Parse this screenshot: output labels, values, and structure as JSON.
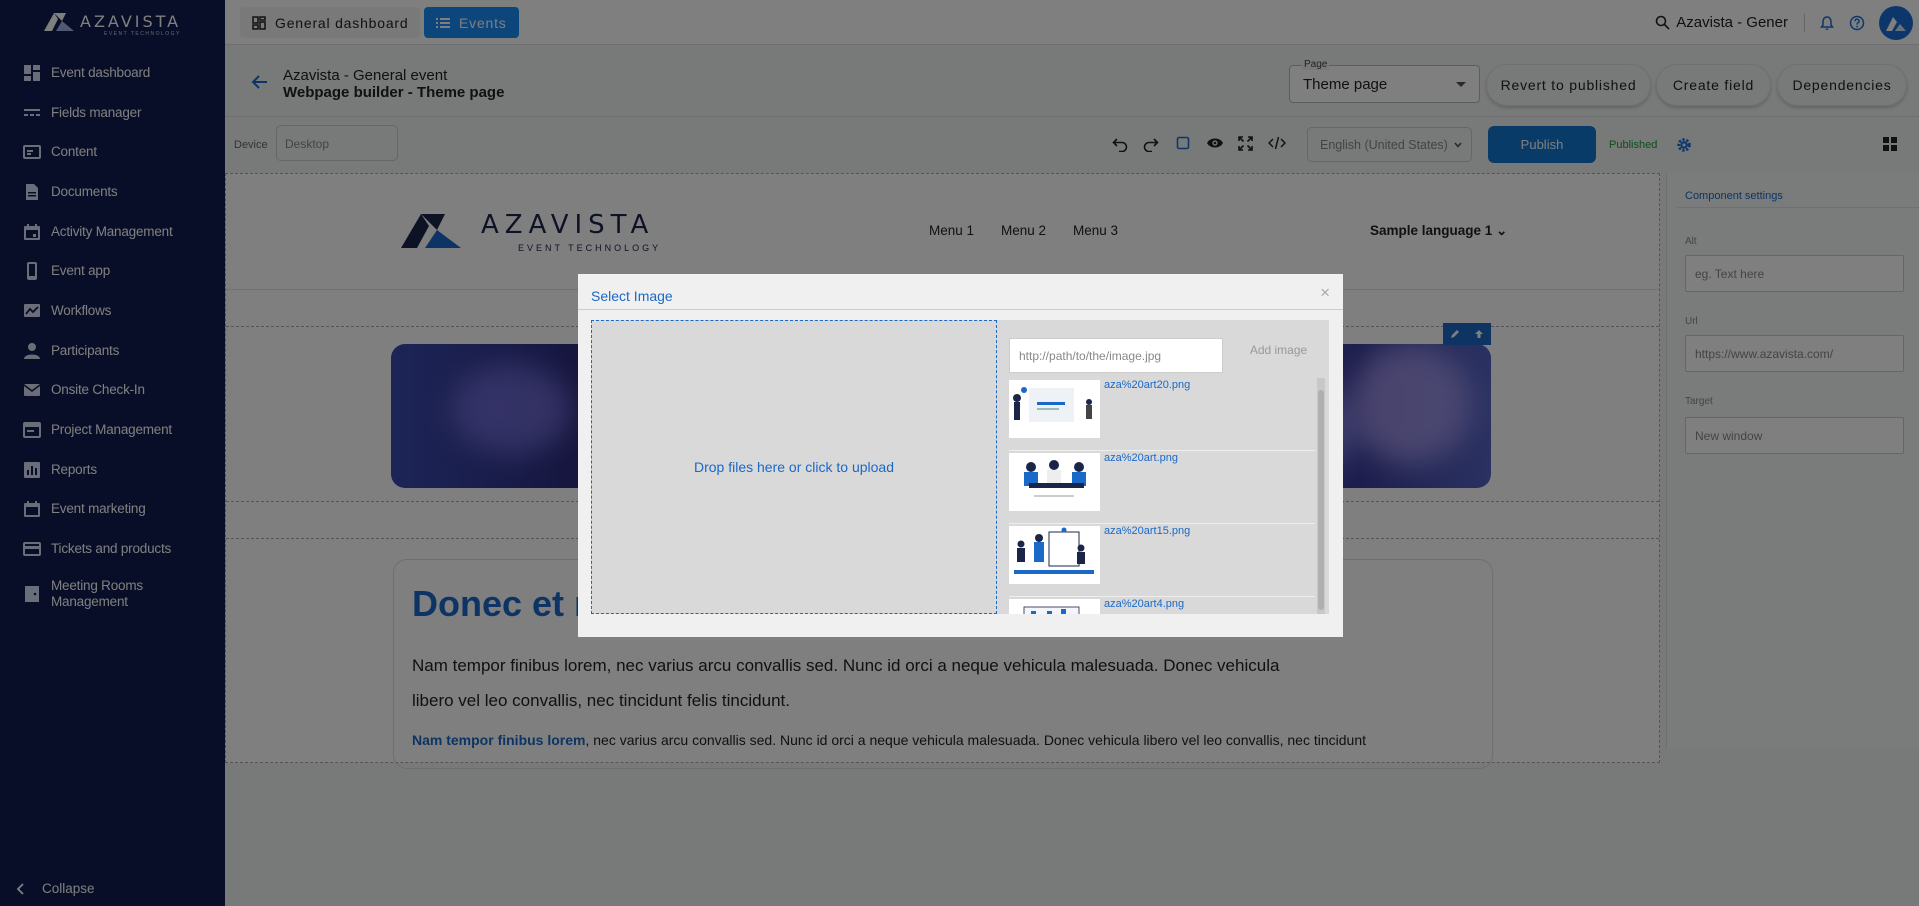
{
  "sidebar": {
    "logo": {
      "word": "AZAVISTA",
      "sub": "EVENT TECHNOLOGY"
    },
    "items": [
      {
        "label": "Event dashboard",
        "icon": "dashboard-icon"
      },
      {
        "label": "Fields manager",
        "icon": "fields-icon"
      },
      {
        "label": "Content",
        "icon": "content-icon"
      },
      {
        "label": "Documents",
        "icon": "document-icon"
      },
      {
        "label": "Activity Management",
        "icon": "calendar-icon"
      },
      {
        "label": "Event app",
        "icon": "phone-icon"
      },
      {
        "label": "Workflows",
        "icon": "workflow-icon"
      },
      {
        "label": "Participants",
        "icon": "person-icon"
      },
      {
        "label": "Onsite Check-In",
        "icon": "mail-icon"
      },
      {
        "label": "Project Management",
        "icon": "project-icon"
      },
      {
        "label": "Reports",
        "icon": "reports-icon"
      },
      {
        "label": "Event marketing",
        "icon": "calendar-icon"
      },
      {
        "label": "Tickets and products",
        "icon": "ticket-icon"
      },
      {
        "label": "Meeting Rooms Management",
        "icon": "meeting-room-icon"
      }
    ],
    "collapse_label": "Collapse"
  },
  "topbar": {
    "tabs": [
      {
        "label": "General dashboard"
      },
      {
        "label": "Events"
      }
    ],
    "search_text": "Azavista - Gener"
  },
  "header": {
    "event_title": "Azavista - General event",
    "page_subtitle": "Webpage builder - Theme page",
    "page_select": {
      "legend": "Page",
      "value": "Theme page"
    },
    "buttons": {
      "revert": "Revert to published",
      "create_field": "Create field",
      "dependencies": "Dependencies"
    }
  },
  "toolbar": {
    "device_label": "Device",
    "device_placeholder": "Desktop",
    "language": "English (United States)",
    "publish": "Publish",
    "status": "Published"
  },
  "canvas": {
    "logo": {
      "word": "AZAVISTA",
      "sub": "EVENT TECHNOLOGY"
    },
    "menu": [
      "Menu 1",
      "Menu 2",
      "Menu 3"
    ],
    "sample_language": "Sample language 1",
    "heading": "Donec et r",
    "paragraph1": "Nam tempor finibus lorem, nec varius arcu convallis sed. Nunc id orci a neque vehicula malesuada. Donec vehicula libero vel leo convallis, nec tincidunt felis tincidunt.",
    "paragraph2_bold": "Nam tempor finibus lorem",
    "paragraph2_rest": ", nec varius arcu convallis sed. Nunc id orci a neque vehicula malesuada. Donec vehicula libero vel leo convallis, nec tincidunt"
  },
  "settings": {
    "title": "Component settings",
    "fields": [
      {
        "label": "Alt",
        "placeholder": "eg. Text here"
      },
      {
        "label": "Url",
        "placeholder": "https://www.azavista.com/"
      },
      {
        "label": "Target",
        "placeholder": "New window"
      }
    ]
  },
  "modal": {
    "title": "Select Image",
    "close": "×",
    "dropzone": "Drop files here or click to upload",
    "url_placeholder": "http://path/to/the/image.jpg",
    "add_image": "Add image",
    "images": [
      {
        "name": "aza%20art20.png"
      },
      {
        "name": "aza%20art.png"
      },
      {
        "name": "aza%20art15.png"
      },
      {
        "name": "aza%20art4.png"
      }
    ]
  },
  "colors": {
    "sidebar": "#101d4e",
    "accent": "#1a8cf5",
    "link": "#1a69c8",
    "published": "#1c9a3a"
  }
}
